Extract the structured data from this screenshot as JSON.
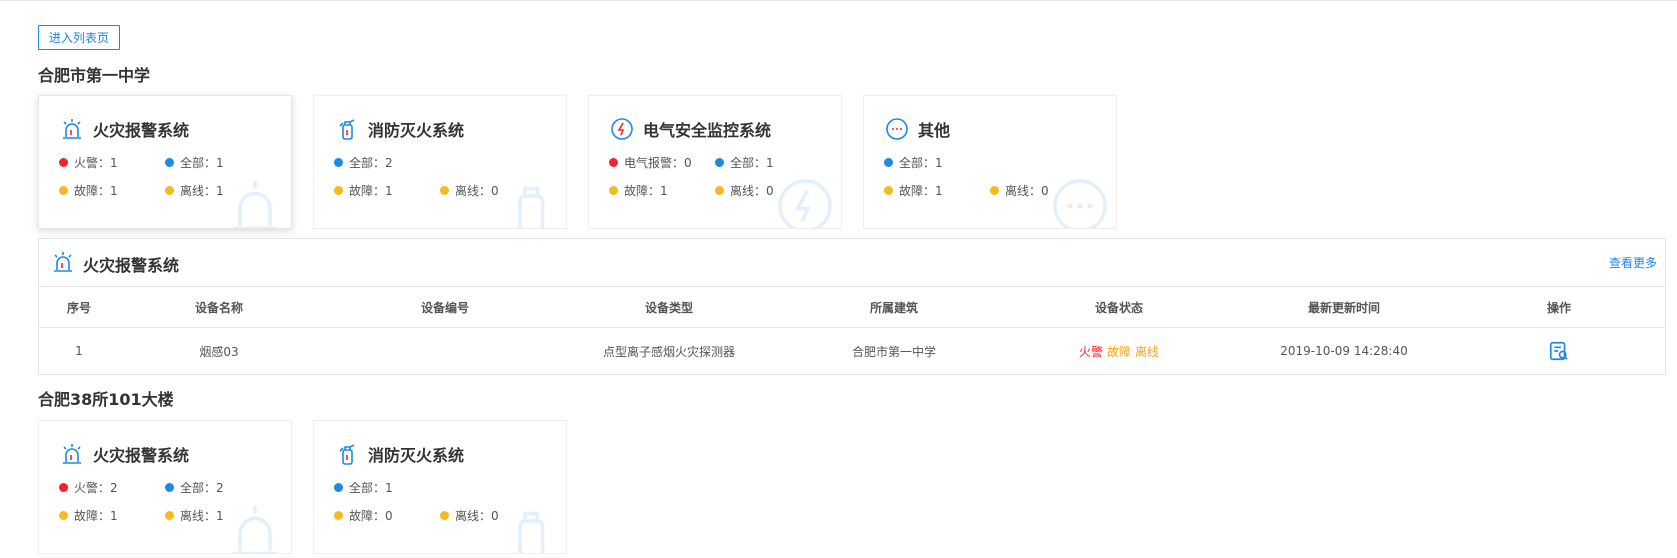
{
  "toolbar": {
    "list_page_label": "进入列表页"
  },
  "sites": [
    {
      "name": "合肥市第一中学",
      "cards": [
        {
          "title": "火灾报警系统",
          "icon": "alarm-light-icon",
          "row1": [
            {
              "color": "red",
              "label": "火警：1"
            },
            {
              "color": "blue",
              "label": "全部：1"
            }
          ],
          "row2": [
            {
              "color": "yellow",
              "label": "故障：1"
            },
            {
              "color": "yellow",
              "label": "离线：1"
            }
          ]
        },
        {
          "title": "消防灭火系统",
          "icon": "fire-extinguisher-icon",
          "row1": [
            {
              "color": "blue",
              "label": "全部：2"
            }
          ],
          "row2": [
            {
              "color": "yellow",
              "label": "故障：1"
            },
            {
              "color": "yellow",
              "label": "离线：0"
            }
          ]
        },
        {
          "title": "电气安全监控系统",
          "icon": "electric-gauge-icon",
          "row1": [
            {
              "color": "red",
              "label": "电气报警：0"
            },
            {
              "color": "blue",
              "label": "全部：1"
            }
          ],
          "row2": [
            {
              "color": "yellow",
              "label": "故障：1"
            },
            {
              "color": "yellow",
              "label": "离线：0"
            }
          ]
        },
        {
          "title": "其他",
          "icon": "more-dots-icon",
          "row1": [
            {
              "color": "blue",
              "label": "全部：1"
            }
          ],
          "row2": [
            {
              "color": "yellow",
              "label": "故障：1"
            },
            {
              "color": "yellow",
              "label": "离线：0"
            }
          ]
        }
      ]
    },
    {
      "name": "合肥38所101大楼",
      "cards": [
        {
          "title": "火灾报警系统",
          "icon": "alarm-light-icon",
          "row1": [
            {
              "color": "red",
              "label": "火警：2"
            },
            {
              "color": "blue",
              "label": "全部：2"
            }
          ],
          "row2": [
            {
              "color": "yellow",
              "label": "故障：1"
            },
            {
              "color": "yellow",
              "label": "离线：1"
            }
          ]
        },
        {
          "title": "消防灭火系统",
          "icon": "fire-extinguisher-icon",
          "row1": [
            {
              "color": "blue",
              "label": "全部：1"
            }
          ],
          "row2": [
            {
              "color": "yellow",
              "label": "故障：0"
            },
            {
              "color": "yellow",
              "label": "离线：0"
            }
          ]
        }
      ]
    }
  ],
  "panel": {
    "title": "火灾报警系统",
    "icon": "alarm-light-icon",
    "more_label": "查看更多",
    "columns": [
      "序号",
      "设备名称",
      "设备编号",
      "设备类型",
      "所属建筑",
      "设备状态",
      "最新更新时间",
      "操作"
    ],
    "rows": [
      {
        "index": "1",
        "name": "烟感03",
        "code": "",
        "type": "点型离子感烟火灾探测器",
        "building": "合肥市第一中学",
        "status_fire": "火警",
        "status_fault": "故障",
        "status_offline": "离线",
        "updated": "2019-10-09 14:28:40",
        "action_icon": "view-detail-icon"
      }
    ]
  },
  "colors": {
    "accent": "#1e88e5",
    "alarm": "#f5222d",
    "warning": "#f8b91c",
    "border": "#e6e6e6"
  }
}
